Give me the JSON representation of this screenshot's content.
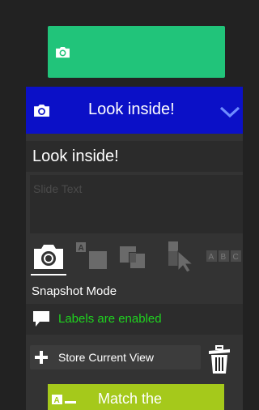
{
  "top_button": {
    "icon": "camera-icon"
  },
  "slide": {
    "header_title": "Look inside!",
    "icon": "camera-icon",
    "collapse_icon": "chevron-down-icon",
    "title_value": "Look inside!",
    "text_placeholder": "Slide Text"
  },
  "mode": {
    "label": "Snapshot Mode",
    "tabs": [
      {
        "icon": "camera-icon",
        "selected": true
      },
      {
        "icon": "label-box-icon",
        "selected": false
      },
      {
        "icon": "layers-icon",
        "selected": false
      },
      {
        "icon": "pointer-label-icon",
        "selected": false
      },
      {
        "icon": "abc-icon",
        "text": "ABC",
        "selected": false
      }
    ]
  },
  "labels_status": {
    "text": "Labels are enabled",
    "icon": "speech-bubble-icon",
    "color": "#1fd41f"
  },
  "store_view": {
    "label": "Store Current View",
    "icon": "plus-icon"
  },
  "delete": {
    "icon": "trash-icon"
  },
  "match_button": {
    "label": "Match the",
    "icon": "label-match-icon"
  },
  "colors": {
    "accent_green": "#21c47a",
    "header_blue": "#0b10c7",
    "match_yellow_green": "#a5c91b",
    "background": "#222222",
    "panel": "#333333"
  }
}
